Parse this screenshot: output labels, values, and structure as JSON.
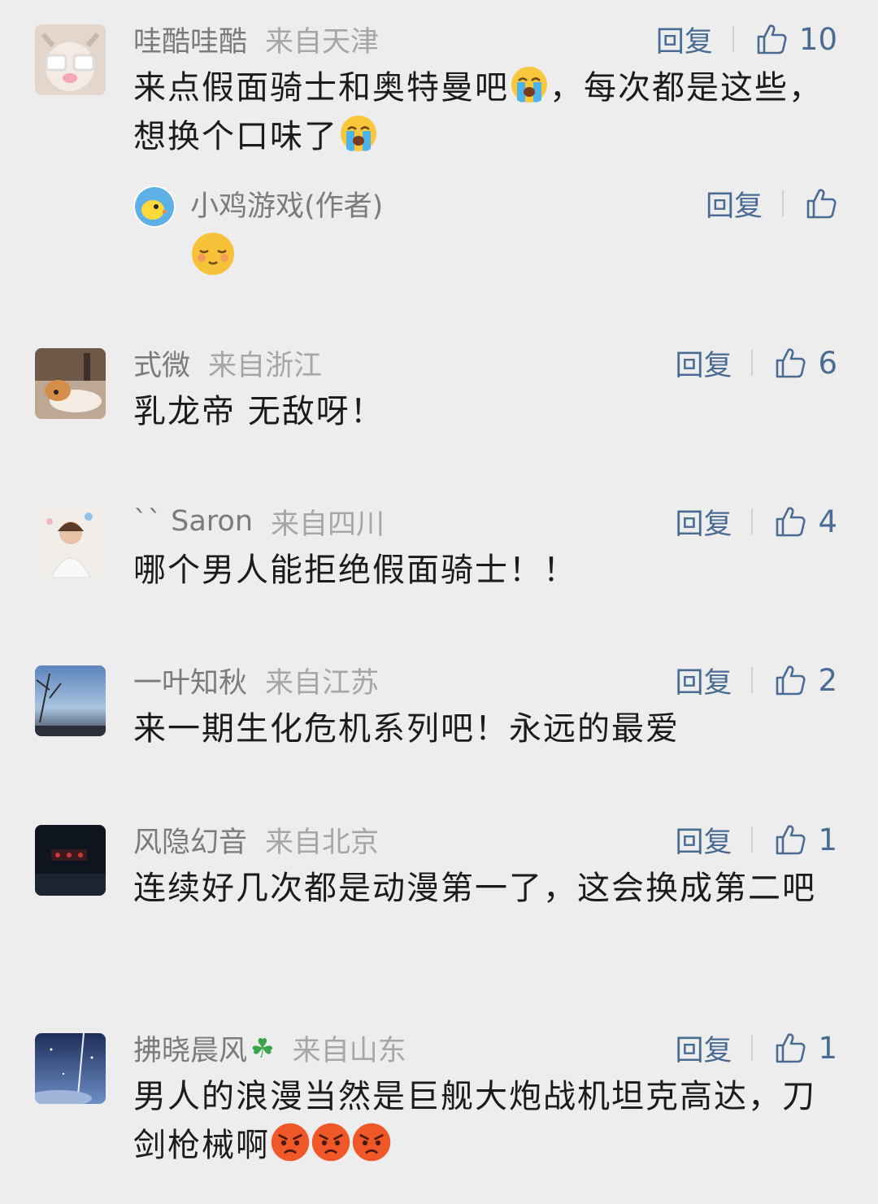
{
  "reply_label": "回复",
  "comments": [
    {
      "name": "哇酷哇酷",
      "location": "来自天津",
      "likes": "10",
      "text_a": "来点假面骑士和奥特曼吧",
      "text_b": "，每次都是这些，想换个口味了",
      "reply": {
        "name": "小鸡游戏(作者)"
      }
    },
    {
      "name": "式微",
      "location": "来自浙江",
      "likes": "6",
      "text": "乳龙帝 无敌呀！"
    },
    {
      "name": "`` Saron",
      "location": "来自四川",
      "likes": "4",
      "text": "哪个男人能拒绝假面骑士！！"
    },
    {
      "name": "一叶知秋",
      "location": "来自江苏",
      "likes": "2",
      "text": "来一期生化危机系列吧！永远的最爱"
    },
    {
      "name": "风隐幻音",
      "location": "来自北京",
      "likes": "1",
      "text": "连续好几次都是动漫第一了，这会换成第二吧"
    },
    {
      "name": "拂晓晨风",
      "location": "来自山东",
      "likes": "1",
      "text": "男人的浪漫当然是巨舰大炮战机坦克高达，刀剑枪械啊"
    }
  ],
  "icons": {
    "thumb": "thumbs-up-icon",
    "crying": "loudly-crying-face-emoji",
    "shy": "smiling-blush-face-emoji",
    "angry": "angry-face-emoji",
    "clover": "four-leaf-clover-icon"
  },
  "colors": {
    "background": "#ededed",
    "action_blue": "#4a6c94",
    "name_gray": "#7b7b7b",
    "location_gray": "#a6a6a6"
  }
}
